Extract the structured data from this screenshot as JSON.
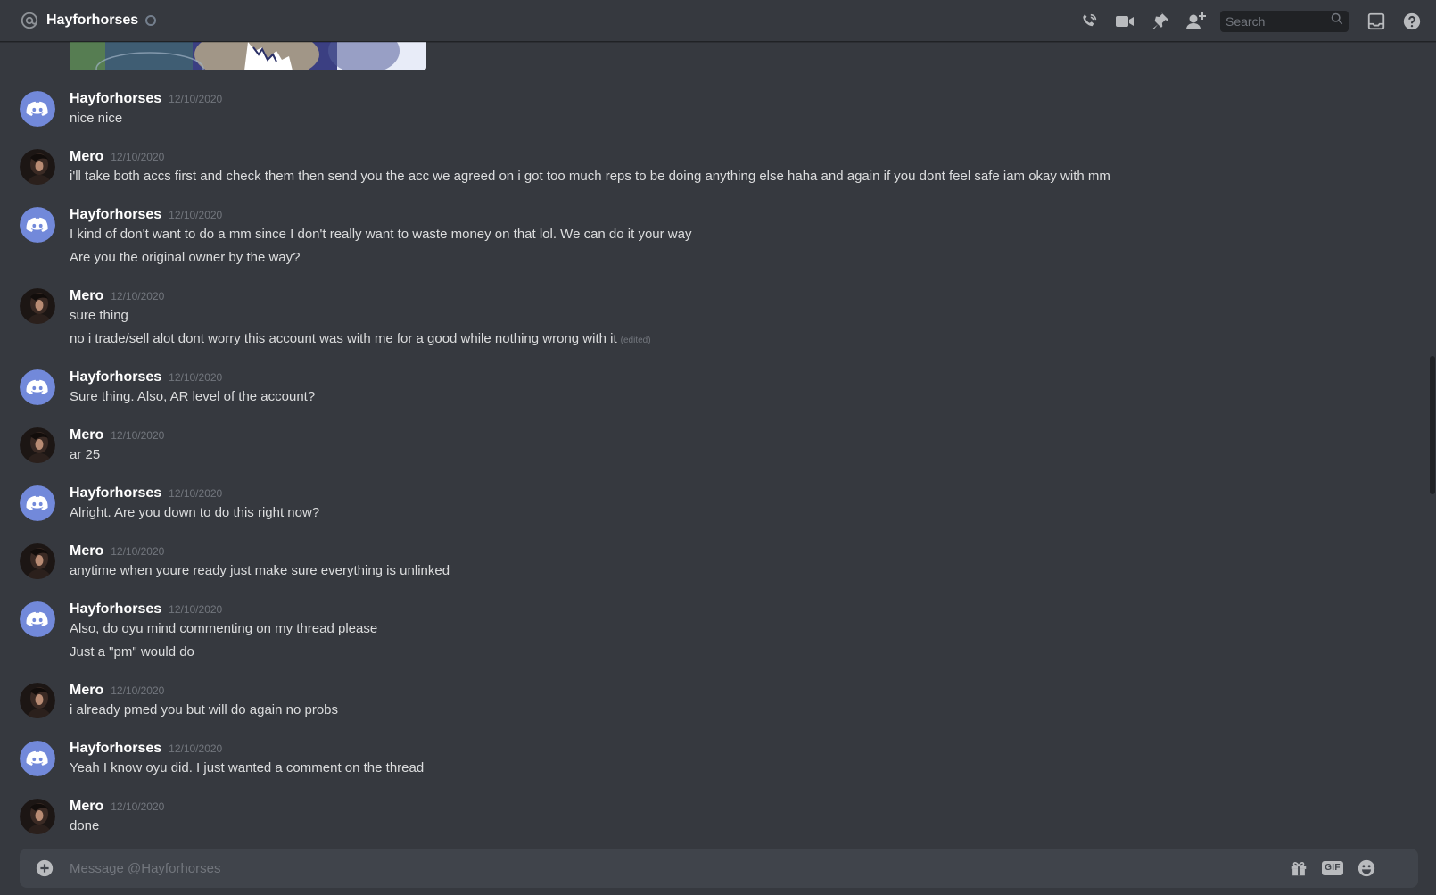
{
  "header": {
    "channel_name": "Hayforhorses",
    "icons": [
      "at-icon",
      "call-icon",
      "video-icon",
      "pin-icon",
      "add-friend-icon",
      "search-icon",
      "inbox-icon",
      "help-icon"
    ],
    "search_placeholder": "Search"
  },
  "messages": [
    {
      "author": "Hayforhorses",
      "timestamp": "12/10/2020",
      "avatar": "discord-default",
      "lines": [
        "nice nice"
      ]
    },
    {
      "author": "Mero",
      "timestamp": "12/10/2020",
      "avatar": "photo",
      "lines": [
        "i'll take both accs first and check them then send you the acc we agreed on i got too much reps to be doing anything else haha and again if you dont feel safe iam okay with mm"
      ]
    },
    {
      "author": "Hayforhorses",
      "timestamp": "12/10/2020",
      "avatar": "discord-default",
      "lines": [
        "I kind of don't want to do a mm since I don't really want to waste money on that lol. We can do it your way",
        "Are you the original owner by the way?"
      ]
    },
    {
      "author": "Mero",
      "timestamp": "12/10/2020",
      "avatar": "photo",
      "lines": [
        "sure thing",
        "no i trade/sell alot dont worry this account was with me for a good while nothing wrong with it"
      ],
      "edited_label": "(edited)"
    },
    {
      "author": "Hayforhorses",
      "timestamp": "12/10/2020",
      "avatar": "discord-default",
      "lines": [
        "Sure thing. Also, AR level of the account?"
      ]
    },
    {
      "author": "Mero",
      "timestamp": "12/10/2020",
      "avatar": "photo",
      "lines": [
        "ar 25"
      ]
    },
    {
      "author": "Hayforhorses",
      "timestamp": "12/10/2020",
      "avatar": "discord-default",
      "lines": [
        "Alright. Are you down to do this right now?"
      ]
    },
    {
      "author": "Mero",
      "timestamp": "12/10/2020",
      "avatar": "photo",
      "lines": [
        "anytime when youre ready just make sure everything is unlinked"
      ]
    },
    {
      "author": "Hayforhorses",
      "timestamp": "12/10/2020",
      "avatar": "discord-default",
      "lines": [
        "Also, do oyu mind commenting on my thread please",
        "Just a \"pm\" would do"
      ]
    },
    {
      "author": "Mero",
      "timestamp": "12/10/2020",
      "avatar": "photo",
      "lines": [
        "i already pmed you but will do again no probs"
      ]
    },
    {
      "author": "Hayforhorses",
      "timestamp": "12/10/2020",
      "avatar": "discord-default",
      "lines": [
        "Yeah I know oyu did. I just wanted a comment on the thread"
      ]
    },
    {
      "author": "Mero",
      "timestamp": "12/10/2020",
      "avatar": "photo",
      "lines": [
        "done"
      ]
    }
  ],
  "composer": {
    "placeholder": "Message @Hayforhorses",
    "gif_label": "GIF",
    "icons": [
      "add-attachment-icon",
      "gift-icon",
      "gif-icon",
      "emoji-icon"
    ]
  },
  "colors": {
    "background": "#36393f",
    "composer_bg": "#40444b",
    "blurple": "#7289da",
    "text": "#dcddde",
    "muted": "#72767d"
  }
}
